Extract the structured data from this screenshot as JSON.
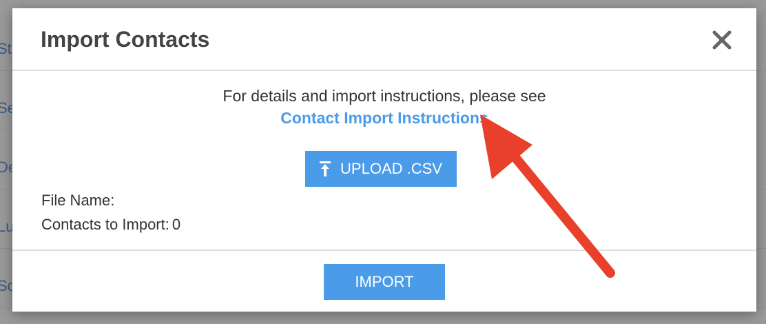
{
  "background": {
    "rows": [
      "St",
      "Se",
      "De",
      "Lu",
      "So"
    ]
  },
  "modal": {
    "title": "Import Contacts",
    "close_icon": "close-icon",
    "intro_text": "For details and import instructions, please see",
    "instructions_link": "Contact Import Instructions",
    "upload_button_label": "UPLOAD .CSV",
    "upload_icon": "upload-icon",
    "file_name_label": "File Name:",
    "contacts_label": "Contacts to Import:",
    "contacts_count": "0",
    "import_button_label": "IMPORT"
  },
  "colors": {
    "accent": "#4a9be8",
    "arrow": "#e8402a"
  }
}
